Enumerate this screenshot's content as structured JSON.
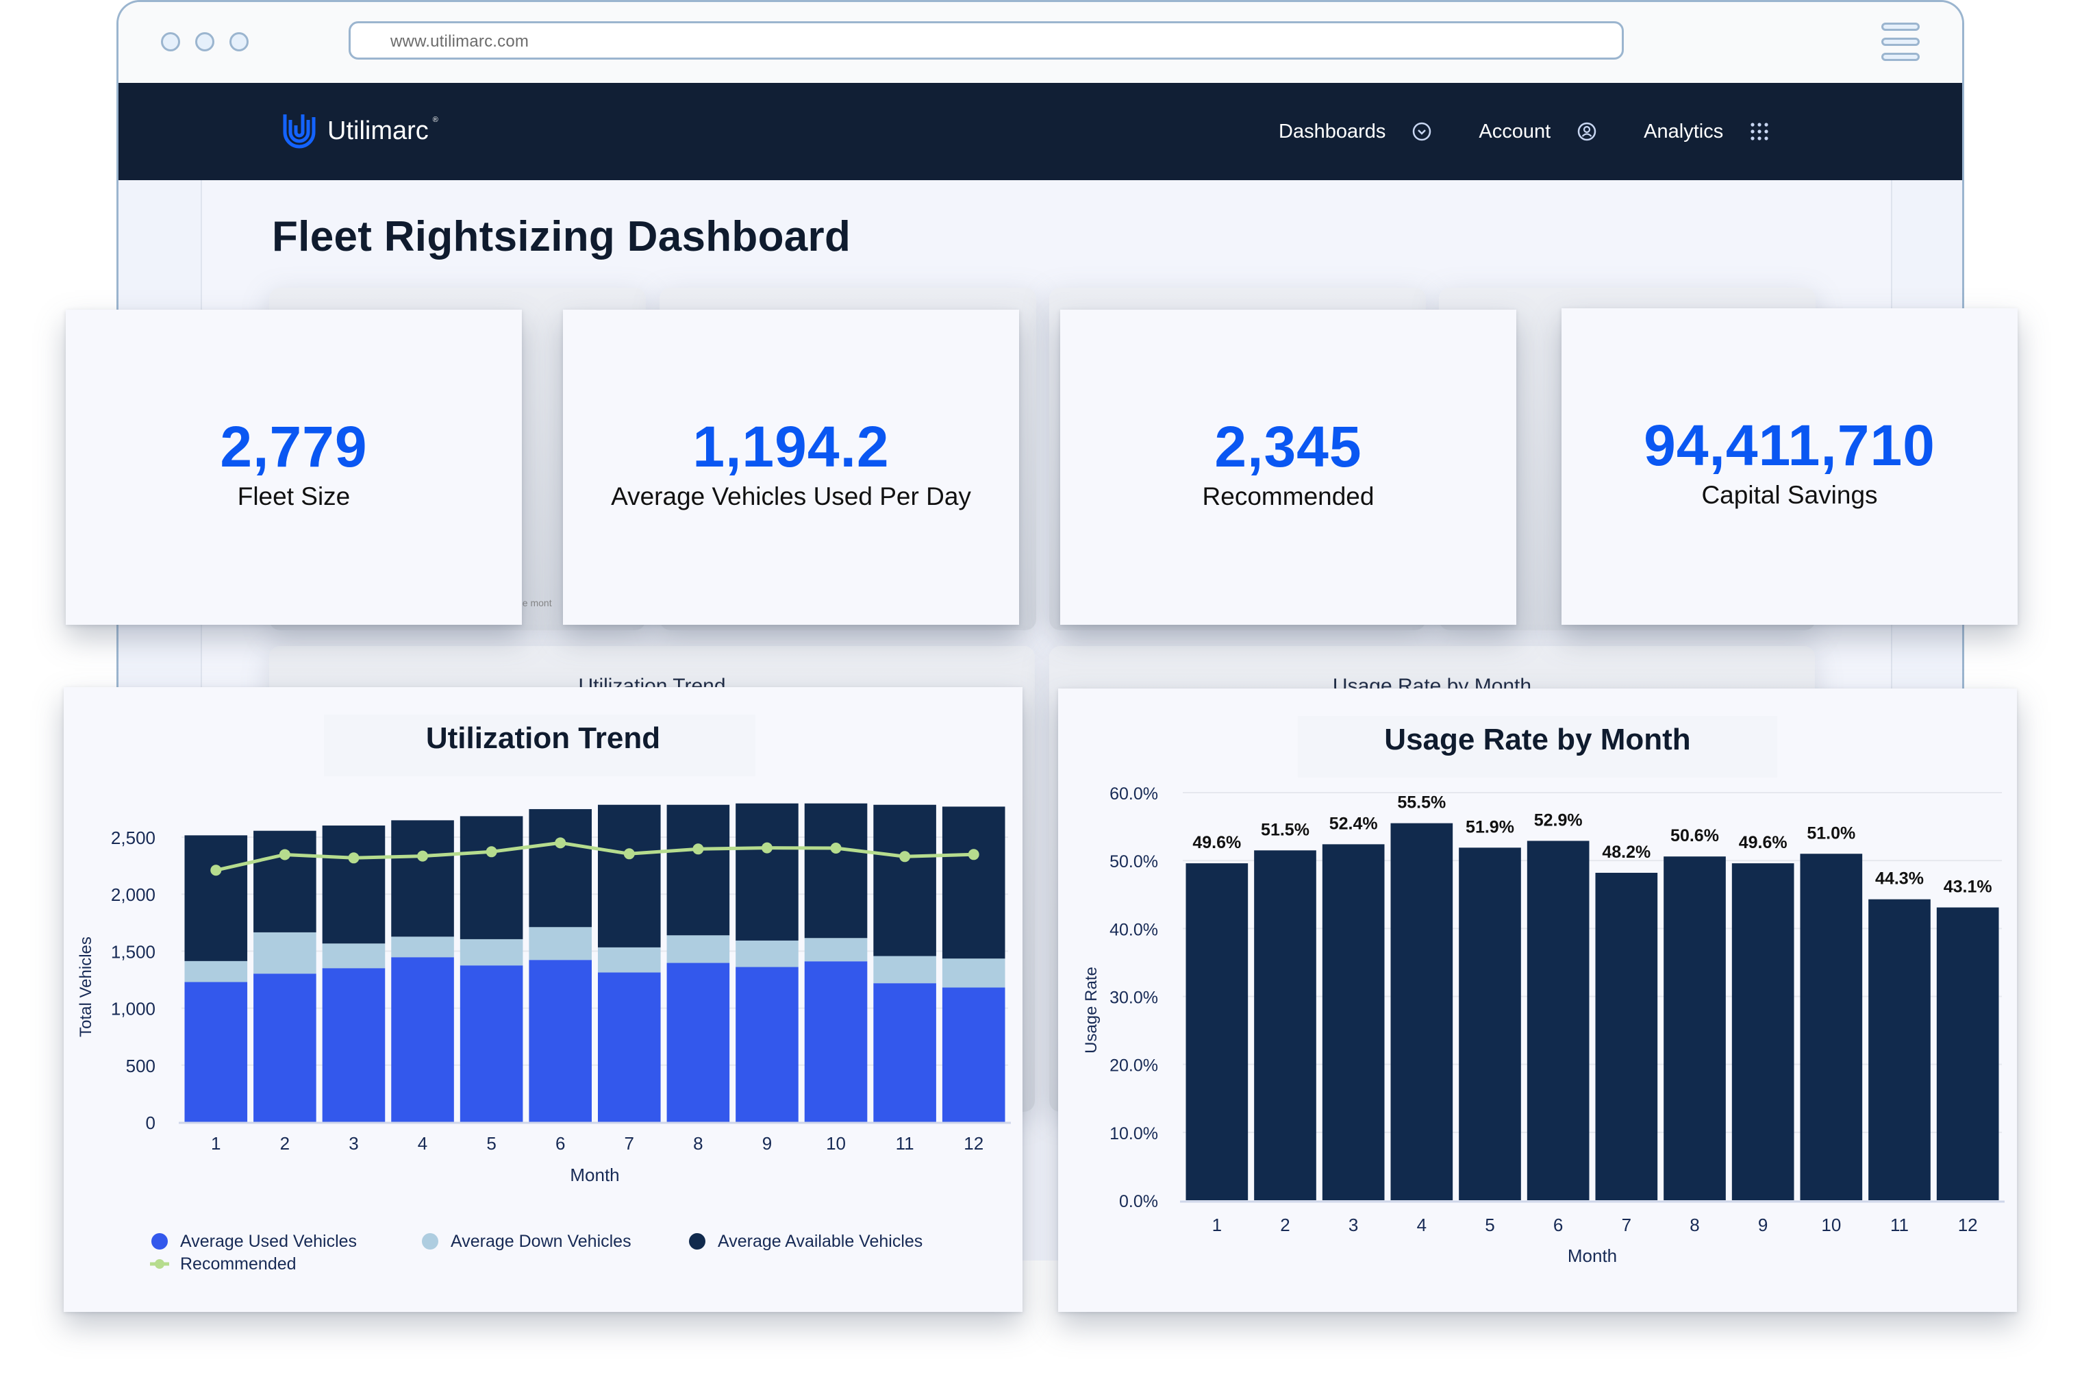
{
  "browser": {
    "url": "www.utilimarc.com"
  },
  "nav": {
    "brand": "Utilimarc",
    "brand_mark": "®",
    "items": [
      {
        "label": "Dashboards",
        "icon": "chevron-down-circle-icon"
      },
      {
        "label": "Account",
        "icon": "user-circle-icon"
      },
      {
        "label": "Analytics",
        "icon": "grid-dots-icon"
      }
    ]
  },
  "page": {
    "title": "Fleet Rightsizing Dashboard",
    "background_note": "he mont"
  },
  "kpis": [
    {
      "value": "2,779",
      "label": "Fleet Size"
    },
    {
      "value": "1,194.2",
      "label": "Average Vehicles Used Per Day"
    },
    {
      "value": "2,345",
      "label": "Recommended"
    },
    {
      "value": "94,411,710",
      "label": "Capital Savings"
    }
  ],
  "background_panels": {
    "left_title": "Utilization Trend",
    "right_title": "Usage Rate by Month"
  },
  "colors": {
    "accent": "#0a57f2",
    "navbar": "#111f35",
    "used": "#3358ec",
    "down": "#aecde0",
    "available": "#112a4d",
    "recommended": "#b6dc8e",
    "usage_bar": "#112a4d"
  },
  "chart_data": [
    {
      "type": "bar",
      "stacked": true,
      "title": "Utilization Trend",
      "xlabel": "Month",
      "ylabel": "Total Vehicles",
      "categories": [
        "1",
        "2",
        "3",
        "4",
        "5",
        "6",
        "7",
        "8",
        "9",
        "10",
        "11",
        "12"
      ],
      "ylim": [
        0,
        2800
      ],
      "yticks": [
        0,
        500,
        1000,
        1500,
        2000,
        2500
      ],
      "ytick_labels": [
        "0",
        "500",
        "1,000",
        "1,500",
        "2,000",
        "2,500"
      ],
      "grid": true,
      "series": [
        {
          "name": "Average Used Vehicles",
          "kind": "bar",
          "color": "#3358ec",
          "values": [
            1229,
            1303,
            1351,
            1447,
            1375,
            1423,
            1313,
            1397,
            1361,
            1411,
            1219,
            1181
          ]
        },
        {
          "name": "Average Down Vehicles",
          "kind": "bar",
          "color": "#aecde0",
          "values": [
            184,
            362,
            216,
            180,
            230,
            288,
            220,
            242,
            232,
            204,
            238,
            254
          ]
        },
        {
          "name": "Average Available Vehicles",
          "kind": "bar",
          "color": "#112a4d",
          "values": [
            1103,
            891,
            1035,
            1021,
            1079,
            1035,
            1251,
            1145,
            1203,
            1181,
            1327,
            1333
          ]
        },
        {
          "name": "Recommended",
          "kind": "line",
          "color": "#b6dc8e",
          "values": [
            2210,
            2347,
            2318,
            2334,
            2372,
            2450,
            2354,
            2396,
            2406,
            2404,
            2330,
            2348
          ]
        }
      ],
      "legend": "bottom-left"
    },
    {
      "type": "bar",
      "title": "Usage Rate by Month",
      "xlabel": "Month",
      "ylabel": "Usage Rate",
      "categories": [
        "1",
        "2",
        "3",
        "4",
        "5",
        "6",
        "7",
        "8",
        "9",
        "10",
        "11",
        "12"
      ],
      "values": [
        49.6,
        51.5,
        52.4,
        55.5,
        51.9,
        52.9,
        48.2,
        50.6,
        49.6,
        51.0,
        44.3,
        43.1
      ],
      "data_labels": [
        "49.6%",
        "51.5%",
        "52.4%",
        "55.5%",
        "51.9%",
        "52.9%",
        "48.2%",
        "50.6%",
        "49.6%",
        "51.0%",
        "44.3%",
        "43.1%"
      ],
      "ylim": [
        0,
        60
      ],
      "yticks": [
        0,
        10,
        20,
        30,
        40,
        50,
        60
      ],
      "ytick_labels": [
        "0.0%",
        "10.0%",
        "20.0%",
        "30.0%",
        "40.0%",
        "50.0%",
        "60.0%"
      ],
      "grid": true,
      "color": "#112a4d"
    }
  ]
}
